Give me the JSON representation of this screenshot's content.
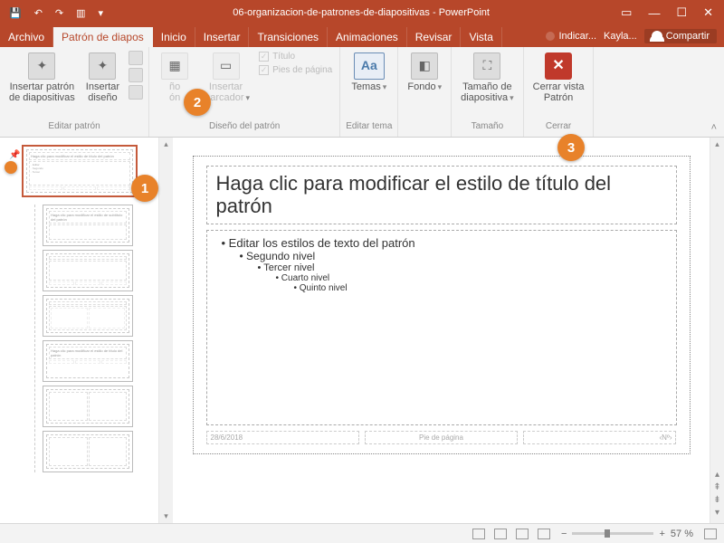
{
  "titlebar": {
    "doc_name": "06-organizacion-de-patrones-de-diapositivas",
    "app_name": "PowerPoint",
    "user": "Kayla..."
  },
  "tabs": {
    "archivo": "Archivo",
    "patron": "Patrón de diapos",
    "inicio": "Inicio",
    "insertar": "Insertar",
    "transiciones": "Transiciones",
    "animaciones": "Animaciones",
    "revisar": "Revisar",
    "vista": "Vista",
    "tell_me": "Indicar...",
    "share": "Compartir"
  },
  "ribbon": {
    "edit_master": {
      "insert_master": "Insertar patrón\nde diapositivas",
      "insert_layout": "Insertar\ndiseño",
      "label": "Editar patrón"
    },
    "master_layout": {
      "layout": "ño\nón",
      "insert_placeholder": "Insertar\nmarcador",
      "chk_title": "Título",
      "chk_footers": "Pies de página",
      "label": "Diseño del patrón"
    },
    "edit_theme": {
      "themes": "Temas",
      "label": "Editar tema"
    },
    "background": {
      "background": "Fondo",
      "label": ""
    },
    "size": {
      "slide_size": "Tamaño de\ndiapositiva",
      "label": "Tamaño"
    },
    "close": {
      "close_master": "Cerrar vista\nPatrón",
      "label": "Cerrar"
    }
  },
  "slide": {
    "title_ph": "Haga clic para modificar el estilo de título del patrón",
    "body_l1": "Editar los estilos de texto del patrón",
    "body_l2": "Segundo nivel",
    "body_l3": "Tercer nivel",
    "body_l4": "Cuarto nivel",
    "body_l5": "Quinto nivel",
    "footer_date": "28/6/2018",
    "footer_center": "Pie de página",
    "footer_num": "‹Nº›"
  },
  "status": {
    "zoom_pct": "57 %"
  },
  "callouts": {
    "c1": "1",
    "c2": "2",
    "c3": "3"
  }
}
